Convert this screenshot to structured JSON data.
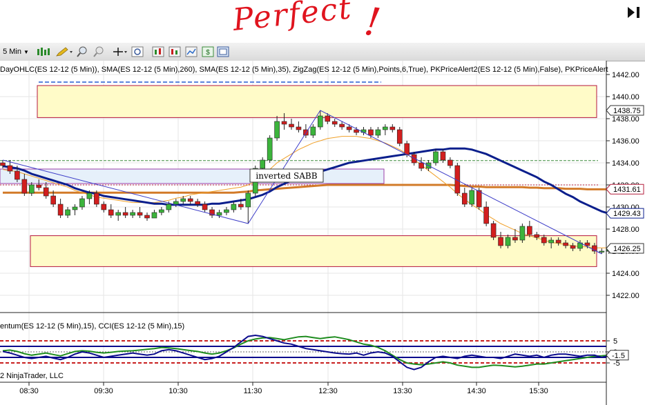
{
  "annotation": {
    "text": "Perfect",
    "exclaim": "!"
  },
  "toolbar": {
    "interval": "5 Min"
  },
  "header": {
    "indicators": "DayOHLC(ES 12-12 (5 Min)), SMA(ES 12-12 (5 Min),260), SMA(ES 12-12 (5 Min),35), ZigZag(ES 12-12 (5 Min),Points,6,True), PKPriceAlert2(ES 12-12 (5 Min),False), PKPriceAlert",
    "lower_panel": "entum(ES 12-12 (5 Min),15), CCI(ES 12-12 (5 Min),15)",
    "copyright": "2 NinjaTrader, LLC"
  },
  "label_box": "inverted SABB",
  "colors": {
    "up": "#3cb43c",
    "down": "#d21e1e",
    "sma_slow": "#d27a28",
    "sma_fast": "#0a1e8c",
    "zigzag": "#3c3cc8",
    "zone": "#fffbc8",
    "zone_border": "#b4143c",
    "momentum": "#1e8c1e",
    "cci": "#0a0a8c"
  },
  "chart_data": {
    "type": "candlestick",
    "title": "",
    "ylim": [
      1421,
      1443
    ],
    "y_ticks": [
      "1442.00",
      "1440.00",
      "1438.00",
      "1436.00",
      "1434.00",
      "1432.00",
      "1430.00",
      "1428.00",
      "1426.00",
      "1424.00",
      "1422.00"
    ],
    "x_ticks": [
      "08:30",
      "09:30",
      "10:30",
      "11:30",
      "12:30",
      "13:30",
      "14:30",
      "15:30"
    ],
    "price_labels": [
      "1438.75",
      "1431.61",
      "1429.43",
      "1426.25",
      "-1.5"
    ],
    "osc_ticks": [
      "5",
      "0",
      "-5"
    ],
    "grid": true,
    "zones": [
      {
        "ymin": 1438.1,
        "ymax": 1441.0
      },
      {
        "ymin": 1424.6,
        "ymax": 1427.4
      }
    ],
    "candles": [
      [
        1434.0,
        1434.25,
        1433.5,
        1433.75
      ],
      [
        1433.75,
        1434.25,
        1433.0,
        1433.25
      ],
      [
        1433.25,
        1433.75,
        1432.25,
        1432.5
      ],
      [
        1432.5,
        1433.0,
        1431.0,
        1431.25
      ],
      [
        1431.25,
        1432.25,
        1431.0,
        1432.0
      ],
      [
        1432.0,
        1432.5,
        1431.5,
        1431.75
      ],
      [
        1431.75,
        1432.25,
        1430.75,
        1431.0
      ],
      [
        1431.0,
        1431.5,
        1430.0,
        1430.25
      ],
      [
        1430.25,
        1430.75,
        1429.0,
        1429.25
      ],
      [
        1429.25,
        1430.0,
        1429.0,
        1429.75
      ],
      [
        1429.75,
        1430.25,
        1429.25,
        1430.0
      ],
      [
        1430.0,
        1431.0,
        1429.75,
        1430.75
      ],
      [
        1430.75,
        1431.5,
        1430.25,
        1431.25
      ],
      [
        1431.25,
        1431.5,
        1430.0,
        1430.25
      ],
      [
        1430.25,
        1430.5,
        1429.5,
        1429.75
      ],
      [
        1429.75,
        1430.25,
        1429.0,
        1429.25
      ],
      [
        1429.25,
        1429.75,
        1428.75,
        1429.5
      ],
      [
        1429.5,
        1430.0,
        1429.0,
        1429.25
      ],
      [
        1429.25,
        1429.75,
        1429.0,
        1429.5
      ],
      [
        1429.5,
        1430.0,
        1429.0,
        1429.25
      ],
      [
        1429.25,
        1429.5,
        1428.75,
        1429.0
      ],
      [
        1429.0,
        1429.75,
        1429.0,
        1429.5
      ],
      [
        1429.5,
        1430.0,
        1429.25,
        1429.75
      ],
      [
        1429.75,
        1430.5,
        1429.5,
        1430.25
      ],
      [
        1430.25,
        1430.75,
        1430.0,
        1430.5
      ],
      [
        1430.5,
        1431.0,
        1430.25,
        1430.75
      ],
      [
        1430.75,
        1431.0,
        1430.25,
        1430.5
      ],
      [
        1430.5,
        1430.75,
        1430.0,
        1430.25
      ],
      [
        1430.25,
        1430.5,
        1429.5,
        1429.75
      ],
      [
        1429.75,
        1430.0,
        1429.0,
        1429.25
      ],
      [
        1429.25,
        1429.75,
        1429.0,
        1429.5
      ],
      [
        1429.5,
        1430.0,
        1429.25,
        1429.75
      ],
      [
        1429.75,
        1430.5,
        1429.5,
        1430.25
      ],
      [
        1430.25,
        1430.75,
        1429.75,
        1430.0
      ],
      [
        1430.0,
        1431.5,
        1428.5,
        1431.25
      ],
      [
        1431.25,
        1433.75,
        1431.0,
        1433.5
      ],
      [
        1433.5,
        1434.5,
        1433.0,
        1434.25
      ],
      [
        1434.25,
        1436.5,
        1434.0,
        1436.25
      ],
      [
        1436.25,
        1438.25,
        1436.0,
        1437.75
      ],
      [
        1437.75,
        1438.5,
        1437.0,
        1437.5
      ],
      [
        1437.5,
        1438.0,
        1437.0,
        1437.25
      ],
      [
        1437.25,
        1437.75,
        1436.75,
        1437.0
      ],
      [
        1437.0,
        1437.5,
        1436.25,
        1436.5
      ],
      [
        1436.5,
        1437.5,
        1436.25,
        1437.25
      ],
      [
        1437.25,
        1438.75,
        1437.0,
        1438.25
      ],
      [
        1438.25,
        1438.5,
        1437.5,
        1437.75
      ],
      [
        1437.75,
        1438.0,
        1437.25,
        1437.5
      ],
      [
        1437.5,
        1437.75,
        1437.0,
        1437.25
      ],
      [
        1437.25,
        1437.5,
        1436.75,
        1437.0
      ],
      [
        1437.0,
        1437.25,
        1436.5,
        1436.75
      ],
      [
        1436.75,
        1437.25,
        1436.5,
        1437.0
      ],
      [
        1437.0,
        1437.25,
        1436.25,
        1436.5
      ],
      [
        1436.5,
        1437.25,
        1436.25,
        1437.0
      ],
      [
        1437.0,
        1437.5,
        1436.5,
        1437.25
      ],
      [
        1437.25,
        1437.5,
        1436.75,
        1437.0
      ],
      [
        1437.0,
        1437.25,
        1435.5,
        1435.75
      ],
      [
        1435.75,
        1436.0,
        1434.5,
        1434.75
      ],
      [
        1434.75,
        1435.0,
        1433.75,
        1434.0
      ],
      [
        1434.0,
        1434.5,
        1433.25,
        1433.5
      ],
      [
        1433.5,
        1434.25,
        1433.25,
        1434.0
      ],
      [
        1434.0,
        1435.25,
        1433.75,
        1435.0
      ],
      [
        1435.0,
        1435.25,
        1434.0,
        1434.25
      ],
      [
        1434.25,
        1434.5,
        1433.5,
        1433.75
      ],
      [
        1433.75,
        1434.0,
        1431.0,
        1431.25
      ],
      [
        1431.25,
        1431.75,
        1430.0,
        1430.25
      ],
      [
        1430.25,
        1431.75,
        1430.0,
        1431.5
      ],
      [
        1431.5,
        1431.75,
        1429.75,
        1430.0
      ],
      [
        1430.0,
        1430.5,
        1428.25,
        1428.5
      ],
      [
        1428.5,
        1428.75,
        1427.0,
        1427.25
      ],
      [
        1427.25,
        1427.75,
        1426.25,
        1426.5
      ],
      [
        1426.5,
        1427.5,
        1426.25,
        1427.25
      ],
      [
        1427.25,
        1428.0,
        1426.75,
        1427.0
      ],
      [
        1427.0,
        1428.5,
        1426.75,
        1428.25
      ],
      [
        1428.25,
        1428.75,
        1427.25,
        1427.5
      ],
      [
        1427.5,
        1427.75,
        1427.0,
        1427.25
      ],
      [
        1427.25,
        1427.5,
        1426.5,
        1426.75
      ],
      [
        1426.75,
        1427.25,
        1426.25,
        1427.0
      ],
      [
        1427.0,
        1427.25,
        1426.5,
        1426.75
      ],
      [
        1426.75,
        1427.0,
        1426.25,
        1426.5
      ],
      [
        1426.5,
        1426.75,
        1426.0,
        1426.25
      ],
      [
        1426.25,
        1427.0,
        1426.0,
        1426.75
      ],
      [
        1426.75,
        1427.0,
        1426.25,
        1426.5
      ],
      [
        1426.5,
        1426.75,
        1425.75,
        1426.0
      ],
      [
        1426.0,
        1426.25,
        1425.75,
        1426.0
      ],
      [
        1426.0,
        1426.25,
        1425.75,
        1426.25
      ],
      [
        1426.25,
        1426.5,
        1426.0,
        1426.25
      ]
    ],
    "sma_fast": [
      1433.7,
      1433.6,
      1433.5,
      1433.3,
      1433.0,
      1432.8,
      1432.6,
      1432.4,
      1432.2,
      1432.0,
      1431.7,
      1431.5,
      1431.3,
      1431.2,
      1431.0,
      1430.9,
      1430.8,
      1430.7,
      1430.6,
      1430.5,
      1430.4,
      1430.3,
      1430.3,
      1430.2,
      1430.2,
      1430.2,
      1430.2,
      1430.2,
      1430.2,
      1430.3,
      1430.3,
      1430.4,
      1430.5,
      1430.6,
      1430.7,
      1430.9,
      1431.1,
      1431.4,
      1431.8,
      1432.1,
      1432.4,
      1432.6,
      1432.8,
      1433.0,
      1433.2,
      1433.4,
      1433.6,
      1433.8,
      1434.0,
      1434.1,
      1434.2,
      1434.3,
      1434.4,
      1434.5,
      1434.6,
      1434.7,
      1434.8,
      1434.9,
      1435.0,
      1435.1,
      1435.2,
      1435.2,
      1435.3,
      1435.3,
      1435.3,
      1435.2,
      1435.0,
      1434.8,
      1434.5,
      1434.2,
      1433.9,
      1433.6,
      1433.3,
      1433.0,
      1432.7,
      1432.3,
      1432.0,
      1431.6,
      1431.2,
      1430.9,
      1430.5,
      1430.2,
      1429.9,
      1429.6,
      1429.4,
      1429.2
    ],
    "sma_slow": [
      1431.3,
      1431.3,
      1431.3,
      1431.3,
      1431.3,
      1431.3,
      1431.3,
      1431.3,
      1431.3,
      1431.3,
      1431.3,
      1431.3,
      1431.3,
      1431.3,
      1431.3,
      1431.3,
      1431.3,
      1431.3,
      1431.3,
      1431.3,
      1431.3,
      1431.3,
      1431.3,
      1431.3,
      1431.3,
      1431.3,
      1431.3,
      1431.3,
      1431.3,
      1431.3,
      1431.3,
      1431.3,
      1431.3,
      1431.35,
      1431.4,
      1431.5,
      1431.55,
      1431.6,
      1431.65,
      1431.7,
      1431.75,
      1431.8,
      1431.85,
      1431.9,
      1431.95,
      1432.0,
      1432.0,
      1432.0,
      1432.0,
      1432.0,
      1432.0,
      1432.0,
      1432.0,
      1432.0,
      1432.0,
      1432.0,
      1432.0,
      1432.0,
      1432.0,
      1432.0,
      1432.0,
      1432.0,
      1432.0,
      1431.95,
      1431.9,
      1431.85,
      1431.85,
      1431.8,
      1431.8,
      1431.8,
      1431.8,
      1431.8,
      1431.8,
      1431.75,
      1431.75,
      1431.7,
      1431.7,
      1431.7,
      1431.65,
      1431.65,
      1431.65,
      1431.6,
      1431.6,
      1431.6,
      1431.6,
      1431.6
    ],
    "sma_mid": [
      1433.4,
      1433.3,
      1433.2,
      1433.0,
      1432.8,
      1432.6,
      1432.4,
      1432.2,
      1432.0,
      1431.8,
      1431.5,
      1431.3,
      1431.1,
      1430.9,
      1430.8,
      1430.7,
      1430.6,
      1430.5,
      1430.4,
      1430.4,
      1430.4,
      1430.4,
      1430.5,
      1430.6,
      1430.8,
      1430.9,
      1431.1,
      1431.2,
      1431.3,
      1431.4,
      1431.5,
      1431.6,
      1431.7,
      1431.8,
      1432.0,
      1432.3,
      1432.8,
      1433.4,
      1434.0,
      1434.4,
      1434.8,
      1435.2,
      1435.5,
      1435.8,
      1436.0,
      1436.2,
      1436.3,
      1436.4,
      1436.4,
      1436.4,
      1436.3,
      1436.2,
      1436.0,
      1435.8,
      1435.5,
      1435.2,
      1434.8,
      1434.3,
      1433.8,
      1433.3,
      1432.8,
      1432.3,
      1431.8,
      1431.2,
      1430.7,
      1430.2,
      1429.8,
      1429.3,
      1428.9,
      1428.5,
      1428.2,
      1427.9,
      1427.6,
      1427.4,
      1427.2,
      1427.0,
      1426.8,
      1426.7,
      1426.6,
      1426.5,
      1426.4,
      1426.4,
      1426.3,
      1426.3,
      1426.3,
      1426.3
    ],
    "zigzag": [
      [
        0,
        1434.25
      ],
      [
        34,
        1428.5
      ],
      [
        44,
        1438.75
      ],
      [
        83,
        1425.75
      ]
    ],
    "horizontal_levels": [
      1434.2,
      1432.0
    ],
    "momentum": [
      0.5,
      0.8,
      0.2,
      -0.8,
      -1.5,
      -1.0,
      -0.5,
      -1.2,
      -1.8,
      -0.8,
      0.2,
      0.5,
      0.3,
      -0.2,
      -0.5,
      -0.2,
      0.2,
      0.4,
      0.5,
      0.8,
      1.2,
      1.5,
      2.0,
      1.8,
      1.5,
      1.0,
      0.6,
      0.2,
      -0.5,
      -1.0,
      -0.5,
      0.5,
      1.8,
      3.5,
      5.0,
      5.8,
      6.3,
      6.5,
      6.0,
      5.5,
      6.2,
      6.8,
      7.0,
      6.5,
      6.0,
      6.5,
      6.8,
      6.2,
      5.5,
      4.5,
      3.5,
      3.0,
      2.0,
      0.5,
      -1.5,
      -3.5,
      -5.0,
      -5.5,
      -5.8,
      -5.5,
      -5.0,
      -4.5,
      -5.0,
      -6.0,
      -6.5,
      -7.0,
      -7.0,
      -6.5,
      -6.0,
      -6.2,
      -6.5,
      -6.8,
      -6.5,
      -6.0,
      -5.5,
      -5.5,
      -5.0,
      -4.5,
      -4.0,
      -3.5,
      -3.0,
      -2.5,
      -2.0,
      -1.8,
      -1.5,
      -1.5
    ],
    "cci": [
      0.2,
      -0.5,
      -1.5,
      -2.5,
      -3.0,
      -2.5,
      -2.0,
      -2.8,
      -3.5,
      -2.5,
      -1.0,
      0.0,
      -0.5,
      -1.5,
      -2.5,
      -2.0,
      -1.5,
      -1.0,
      -0.5,
      -1.0,
      -1.5,
      -1.0,
      0.5,
      1.0,
      0.5,
      -0.5,
      -1.5,
      -2.5,
      -3.5,
      -3.0,
      -2.0,
      0.0,
      2.0,
      4.5,
      7.0,
      7.5,
      7.0,
      6.0,
      5.0,
      4.0,
      3.5,
      2.5,
      1.5,
      1.0,
      0.5,
      0.0,
      -0.5,
      -0.8,
      -1.0,
      -0.5,
      -1.5,
      -0.5,
      0.0,
      -0.5,
      -2.0,
      -4.5,
      -7.0,
      -8.0,
      -7.0,
      -4.5,
      -2.5,
      -2.0,
      -2.5,
      -3.0,
      -2.0,
      -1.5,
      -2.0,
      -2.5,
      -2.5,
      -3.0,
      -2.0,
      -1.0,
      -1.5,
      -2.0,
      -1.5,
      -2.5,
      -1.5,
      -1.0,
      -1.0,
      -1.5,
      -2.0,
      -1.5,
      -1.5,
      -2.5,
      -1.8,
      -1.5
    ],
    "osc_levels": [
      5,
      2.5,
      0,
      -2.5,
      -5
    ]
  }
}
